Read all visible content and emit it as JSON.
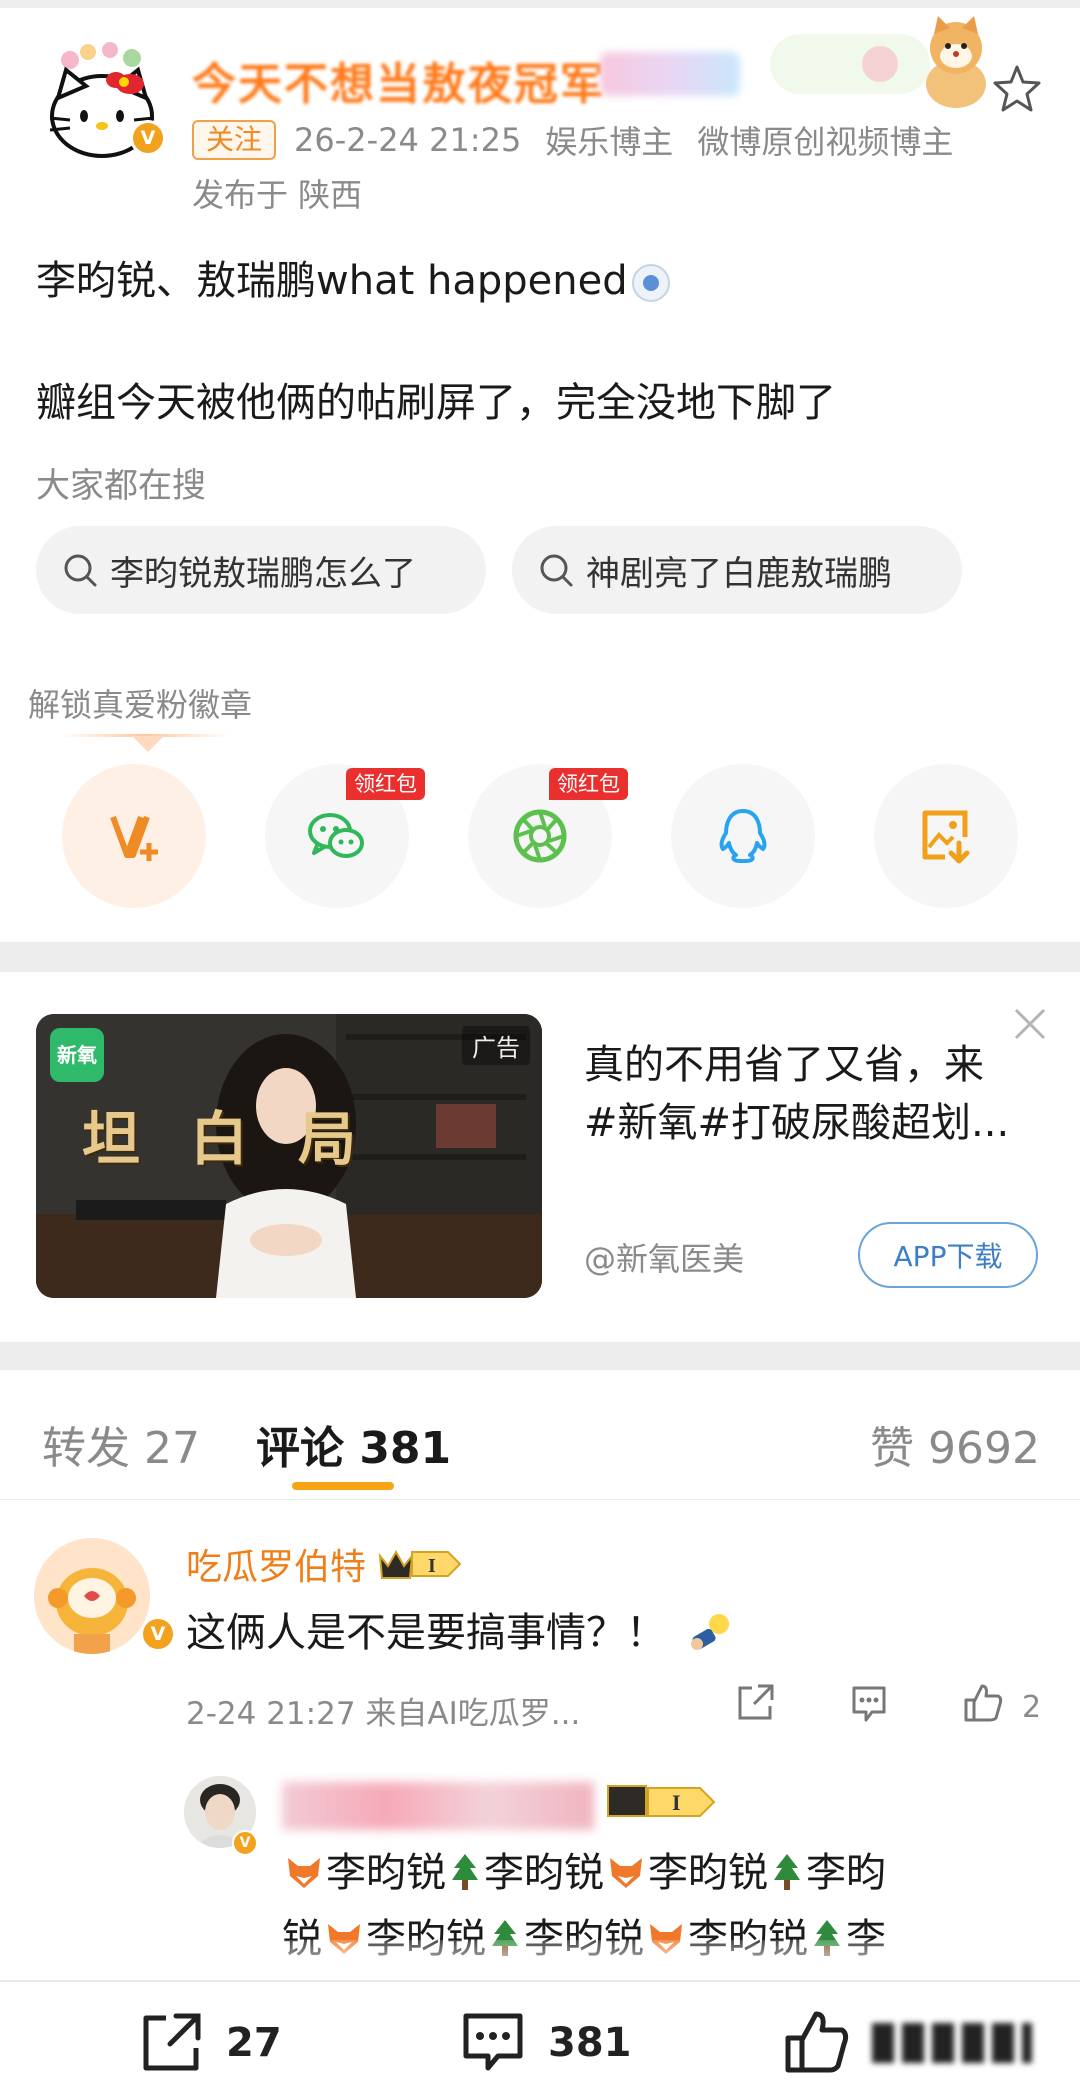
{
  "post": {
    "username": "今天不想当敖夜冠军",
    "follow_label": "关注",
    "timestamp": "26-2-24 21:25",
    "tag1": "娱乐博主",
    "tag2": "微博原创视频博主",
    "location": "发布于 陕西",
    "line1": "李昀锐、敖瑞鹏what happened",
    "line2": "瓣组今天被他俩的帖刷屏了，完全没地下脚了"
  },
  "search": {
    "title": "大家都在搜",
    "chips": [
      "李昀锐敖瑞鹏怎么了",
      "神剧亮了白鹿敖瑞鹏"
    ]
  },
  "unlock": {
    "title": "解锁真爱粉徽章",
    "redpack_label": "领红包",
    "share_icons": [
      "v-plus-icon",
      "wechat-icon",
      "moments-icon",
      "qq-icon",
      "save-image-icon"
    ]
  },
  "ad": {
    "tag": "广告",
    "logo": "新氧",
    "banner": "坦白局",
    "text1": "真的不用省了又省，来",
    "text2": "#新氧#打破尿酸超划...",
    "source": "@新氧医美",
    "button": "APP下载"
  },
  "tabs": {
    "repost": "转发 27",
    "comments": "评论 381",
    "likes": "赞 9692"
  },
  "comment": {
    "user": "吃瓜罗伯特",
    "level": "I",
    "text": "这俩人是不是要搞事情？！",
    "meta": "2-24 21:27  来自AI吃瓜罗...",
    "likes": "2",
    "reply_level": "I",
    "reply_name_1": "李昀锐",
    "reply_name_2": "李昀锐",
    "reply_name_3": "李昀锐",
    "reply_name_4": "李昀",
    "reply_name_5": "锐",
    "reply_name_6": "李昀锐",
    "reply_name_7": "李昀锐",
    "reply_name_8": "李昀锐",
    "reply_name_9": "李"
  },
  "toolbar": {
    "repost_count": "27",
    "comment_count": "381"
  },
  "colors": {
    "accent_orange": "#ff7a1a",
    "tab_indicator": "#f8a417",
    "redpack": "#e9302f",
    "link_blue": "#3b7fc4"
  }
}
